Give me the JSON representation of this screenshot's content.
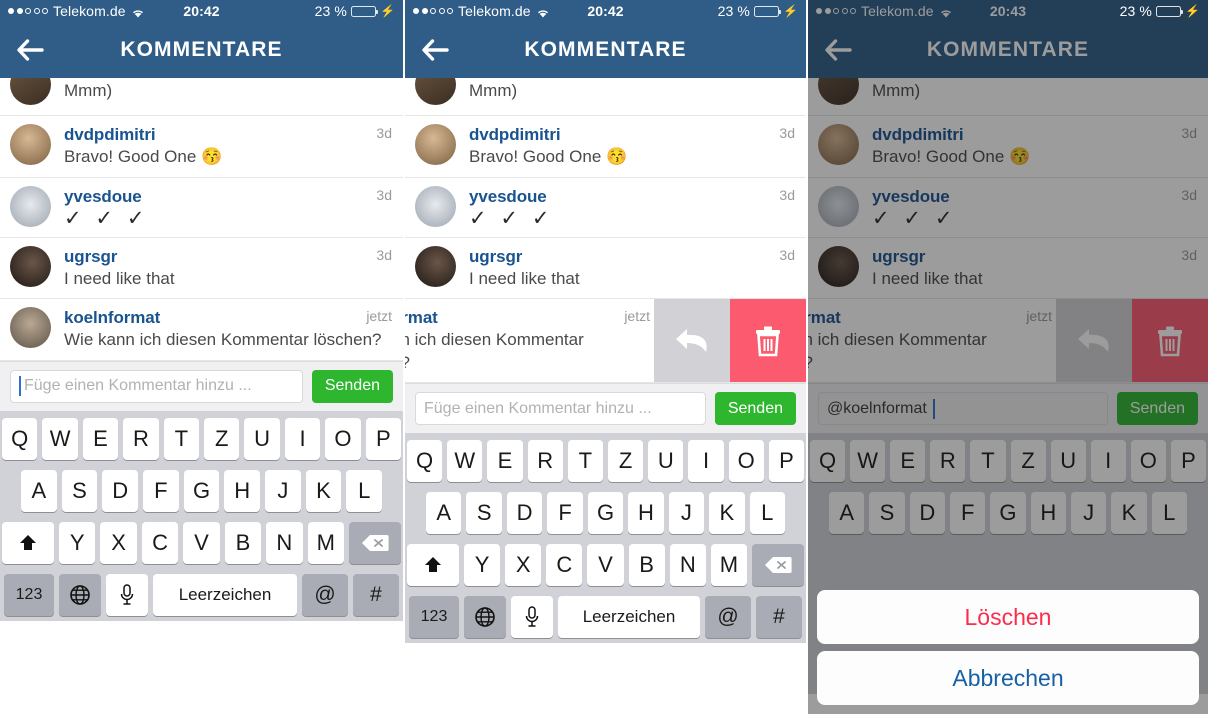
{
  "panels": [
    {
      "id": "panel-1-typing",
      "statusbar": {
        "carrier": "Telekom.de",
        "time": "20:42",
        "battery_pct": "23 %",
        "signal_dots_filled": 2,
        "signal_dots_total": 5,
        "battery_level": 23,
        "charging": true
      },
      "navbar": {
        "title": "KOMMENTARE",
        "back_icon": "back-arrow-icon"
      },
      "comments": [
        {
          "username": "",
          "text": "Mmm)",
          "age": "",
          "partial": true,
          "avatar_color": "#7d6652"
        },
        {
          "username": "dvdpdimitri",
          "text": "Bravo! Good One 😚",
          "age": "3d",
          "partial": false,
          "avatar_color": "#a98f6b"
        },
        {
          "username": "yvesdoue",
          "text": "✓ ✓ ✓",
          "age": "3d",
          "partial": false,
          "avatar_color": "#c8cdd3",
          "big": true
        },
        {
          "username": "ugrsgr",
          "text": "I need like that",
          "age": "3d",
          "partial": false,
          "avatar_color": "#4a3a30"
        },
        {
          "username": "koelnformat",
          "text": "Wie kann ich diesen Kommentar löschen?",
          "age": "jetzt",
          "partial": false,
          "avatar_color": "#9a8a78"
        }
      ],
      "input": {
        "placeholder": "Füge einen Kommentar hinzu ...",
        "value": "",
        "send_label": "Senden"
      },
      "swipe_actions_visible": false,
      "action_sheet_visible": false,
      "keyboard_rows_visible": 4,
      "dimmed": false
    },
    {
      "id": "panel-2-swipe",
      "statusbar": {
        "carrier": "Telekom.de",
        "time": "20:42",
        "battery_pct": "23 %",
        "signal_dots_filled": 2,
        "signal_dots_total": 5,
        "battery_level": 23,
        "charging": true
      },
      "navbar": {
        "title": "KOMMENTARE",
        "back_icon": "back-arrow-icon"
      },
      "comments": [
        {
          "username": "",
          "text": "Mmm)",
          "age": "",
          "partial": true,
          "avatar_color": "#7d6652"
        },
        {
          "username": "dvdpdimitri",
          "text": "Bravo! Good One 😚",
          "age": "3d",
          "partial": false,
          "avatar_color": "#a98f6b"
        },
        {
          "username": "yvesdoue",
          "text": "✓ ✓ ✓",
          "age": "3d",
          "partial": false,
          "avatar_color": "#c8cdd3",
          "big": true
        },
        {
          "username": "ugrsgr",
          "text": "I need like that",
          "age": "3d",
          "partial": false,
          "avatar_color": "#4a3a30"
        },
        {
          "username": "ormat",
          "text": "nn ich diesen Kommentar\nn?",
          "age": "jetzt",
          "partial": false,
          "avatar_color": "#9a8a78",
          "swiped": true
        }
      ],
      "swipe": {
        "reply_icon": "reply-arrow-icon",
        "delete_icon": "trash-icon",
        "reply_color": "#d2d2d6",
        "delete_color": "#fc5a6e"
      },
      "input": {
        "placeholder": "Füge einen Kommentar hinzu ...",
        "value": "",
        "send_label": "Senden"
      },
      "swipe_actions_visible": true,
      "action_sheet_visible": false,
      "keyboard_rows_visible": 4,
      "dimmed": false
    },
    {
      "id": "panel-3-confirm",
      "statusbar": {
        "carrier": "Telekom.de",
        "time": "20:43",
        "battery_pct": "23 %",
        "signal_dots_filled": 2,
        "signal_dots_total": 5,
        "battery_level": 23,
        "charging": true
      },
      "navbar": {
        "title": "KOMMENTARE",
        "back_icon": "back-arrow-icon"
      },
      "comments": [
        {
          "username": "",
          "text": "Mmm)",
          "age": "",
          "partial": true,
          "avatar_color": "#7d6652"
        },
        {
          "username": "dvdpdimitri",
          "text": "Bravo! Good One 😚",
          "age": "3d",
          "partial": false,
          "avatar_color": "#a98f6b"
        },
        {
          "username": "yvesdoue",
          "text": "✓ ✓ ✓",
          "age": "3d",
          "partial": false,
          "avatar_color": "#c8cdd3",
          "big": true
        },
        {
          "username": "ugrsgr",
          "text": "I need like that",
          "age": "3d",
          "partial": false,
          "avatar_color": "#4a3a30"
        },
        {
          "username": "ormat",
          "text": "nn ich diesen Kommentar\nn?",
          "age": "jetzt",
          "partial": false,
          "avatar_color": "#9a8a78",
          "swiped": true
        }
      ],
      "swipe": {
        "reply_icon": "reply-arrow-icon",
        "delete_icon": "trash-icon",
        "reply_color": "#d2d2d6",
        "delete_color": "#fc5a6e"
      },
      "input": {
        "placeholder": "Füge einen Kommentar hinzu ...",
        "value": "@koelnformat",
        "send_label": "Senden"
      },
      "action_sheet": {
        "destructive_label": "Löschen",
        "cancel_label": "Abbrechen"
      },
      "swipe_actions_visible": true,
      "action_sheet_visible": true,
      "keyboard_rows_visible": 2,
      "dimmed": true
    }
  ],
  "keyboard": {
    "row1": [
      "Q",
      "W",
      "E",
      "R",
      "T",
      "Z",
      "U",
      "I",
      "O",
      "P"
    ],
    "row2": [
      "A",
      "S",
      "D",
      "F",
      "G",
      "H",
      "J",
      "K",
      "L"
    ],
    "row3": [
      "Y",
      "X",
      "C",
      "V",
      "B",
      "N",
      "M"
    ],
    "shift_icon": "shift-up-arrow-icon",
    "backspace_icon": "backspace-delete-icon",
    "numbers_label": "123",
    "globe_icon": "globe-language-icon",
    "mic_icon": "microphone-icon",
    "space_label": "Leerzeichen",
    "at_label": "@",
    "hash_label": "#"
  },
  "colors": {
    "navbar": "#2f5d87",
    "username_link": "#1a5490",
    "send_green": "#2fb62f",
    "delete_red": "#fc5a6e",
    "reply_grey": "#d2d2d6",
    "keyboard_bg": "#d0d2d7",
    "sheet_destructive": "#fb2c4c",
    "sheet_cancel": "#1760a5",
    "battery_green": "#4cd964"
  }
}
